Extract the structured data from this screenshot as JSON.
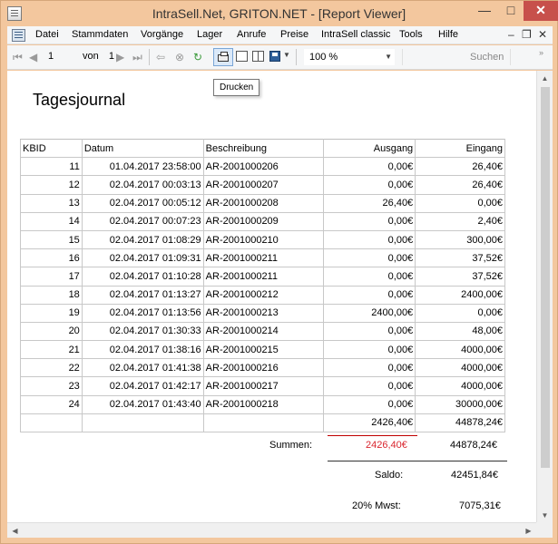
{
  "window": {
    "title": "IntraSell.Net, GRITON.NET - [Report Viewer]",
    "minimize": "—",
    "maximize": "□",
    "close": "✕"
  },
  "menu": {
    "items": [
      "Datei",
      "Stammdaten",
      "Vorgänge",
      "Lager",
      "Anrufe",
      "Preise",
      "IntraSell classic",
      "Tools",
      "Hilfe"
    ],
    "mdi_minimize": "–",
    "mdi_restore": "❐",
    "mdi_close": "✕"
  },
  "toolbar": {
    "page": "1",
    "of_label": "von",
    "total_pages": "1",
    "zoom": "100 %",
    "search_label": "Suchen",
    "tooltip": "Drucken"
  },
  "report": {
    "title": "Tagesjournal",
    "columns": [
      "KBID",
      "Datum",
      "Beschreibung",
      "Ausgang",
      "Eingang"
    ],
    "rows": [
      [
        "11",
        "01.04.2017 23:58:00",
        "AR-2001000206",
        "0,00€",
        "26,40€"
      ],
      [
        "12",
        "02.04.2017 00:03:13",
        "AR-2001000207",
        "0,00€",
        "26,40€"
      ],
      [
        "13",
        "02.04.2017 00:05:12",
        "AR-2001000208",
        "26,40€",
        "0,00€"
      ],
      [
        "14",
        "02.04.2017 00:07:23",
        "AR-2001000209",
        "0,00€",
        "2,40€"
      ],
      [
        "15",
        "02.04.2017 01:08:29",
        "AR-2001000210",
        "0,00€",
        "300,00€"
      ],
      [
        "16",
        "02.04.2017 01:09:31",
        "AR-2001000211",
        "0,00€",
        "37,52€"
      ],
      [
        "17",
        "02.04.2017 01:10:28",
        "AR-2001000211",
        "0,00€",
        "37,52€"
      ],
      [
        "18",
        "02.04.2017 01:13:27",
        "AR-2001000212",
        "0,00€",
        "2400,00€"
      ],
      [
        "19",
        "02.04.2017 01:13:56",
        "AR-2001000213",
        "2400,00€",
        "0,00€"
      ],
      [
        "20",
        "02.04.2017 01:30:33",
        "AR-2001000214",
        "0,00€",
        "48,00€"
      ],
      [
        "21",
        "02.04.2017 01:38:16",
        "AR-2001000215",
        "0,00€",
        "4000,00€"
      ],
      [
        "22",
        "02.04.2017 01:41:38",
        "AR-2001000216",
        "0,00€",
        "4000,00€"
      ],
      [
        "23",
        "02.04.2017 01:42:17",
        "AR-2001000217",
        "0,00€",
        "4000,00€"
      ],
      [
        "24",
        "02.04.2017 01:43:40",
        "AR-2001000218",
        "0,00€",
        "30000,00€"
      ]
    ],
    "totals_row": [
      "",
      "",
      "",
      "2426,40€",
      "44878,24€"
    ],
    "summen_label": "Summen:",
    "summen_out": "2426,40€",
    "summen_in": "44878,24€",
    "saldo_label": "Saldo:",
    "saldo_value": "42451,84€",
    "mwst_label": "20% Mwst:",
    "mwst_value": "7075,31€"
  },
  "colors": {
    "title_bar": "#f3c79e",
    "close_button": "#c7504b",
    "negative_sum": "#d9252e"
  }
}
